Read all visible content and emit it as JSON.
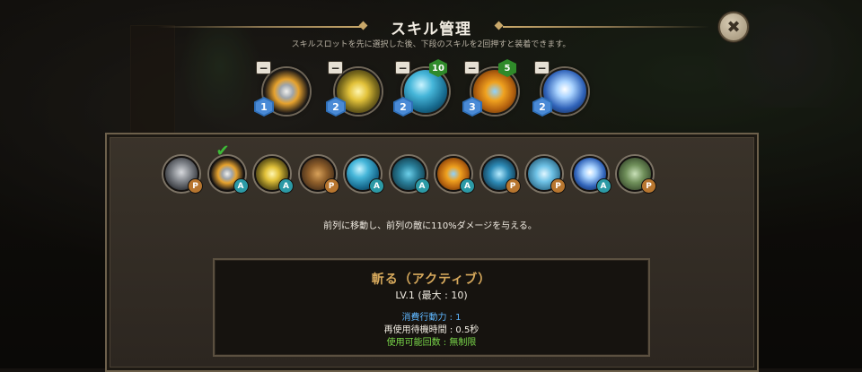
{
  "header": {
    "title": "スキル管理",
    "subtitle": "スキルスロットを先に選択した後、下段のスキルを2回押すと装着できます。",
    "close_label": "✖"
  },
  "equipped_slots": [
    {
      "icon": "blade-slash-icon",
      "remove_label": "−",
      "cost": "1",
      "count": ""
    },
    {
      "icon": "lightning-bolt-icon",
      "remove_label": "−",
      "cost": "2",
      "count": ""
    },
    {
      "icon": "water-orb-icon",
      "remove_label": "−",
      "cost": "2",
      "count": "10"
    },
    {
      "icon": "golden-shield-icon",
      "remove_label": "−",
      "cost": "3",
      "count": "5"
    },
    {
      "icon": "ice-burst-icon",
      "remove_label": "−",
      "cost": "2",
      "count": ""
    }
  ],
  "skills": [
    {
      "icon": "armored-knight-icon",
      "type": "P",
      "selected": false
    },
    {
      "icon": "blade-slash-icon",
      "type": "A",
      "selected": true,
      "selected_mark": "✔"
    },
    {
      "icon": "lightning-bolt-icon",
      "type": "A",
      "selected": false
    },
    {
      "icon": "axe-strike-icon",
      "type": "P",
      "selected": false
    },
    {
      "icon": "water-orb-icon",
      "type": "A",
      "selected": false
    },
    {
      "icon": "hex-shield-icon",
      "type": "A",
      "selected": false
    },
    {
      "icon": "golden-shield-icon",
      "type": "A",
      "selected": false
    },
    {
      "icon": "water-wave-icon",
      "type": "P",
      "selected": false
    },
    {
      "icon": "ice-shield-icon",
      "type": "P",
      "selected": false
    },
    {
      "icon": "ice-burst-icon",
      "type": "A",
      "selected": false
    },
    {
      "icon": "money-bundle-icon",
      "type": "P",
      "selected": false
    }
  ],
  "description": "前列に移動し、前列の敵に110%ダメージを与える。",
  "detail": {
    "name": "斬る（アクティブ）",
    "level": "LV.1 (最大 : 10)",
    "cost": "消費行動力 : 1",
    "cooldown": "再使用待機時間 : 0.5秒",
    "uses": "使用可能回数 : 無制限"
  },
  "colors": {
    "accent_gold": "#d7a95c",
    "cost_blue": "#5fb7ff",
    "uses_green": "#7ad84a",
    "passive_badge": "#b8762f",
    "active_badge": "#2c9aa6"
  }
}
